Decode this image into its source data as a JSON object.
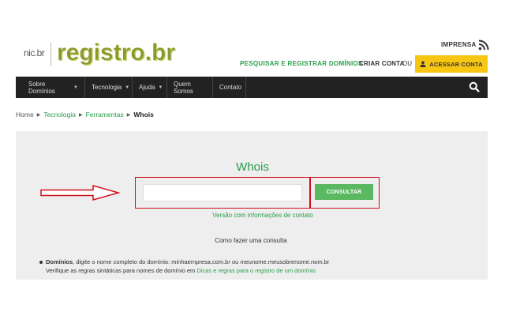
{
  "header": {
    "logo_small": "nic.br",
    "logo_main": "registro.br",
    "imprensa": "IMPRENSA",
    "pesquisar": "PESQUISAR E REGISTRAR DOMÍNIOS",
    "criar_conta": "CRIAR CONTA",
    "ou": "OU",
    "acessar_conta": "ACESSAR CONTA",
    "accent_color": "#2a9d4a",
    "button_color": "#f6c613"
  },
  "nav": {
    "items": [
      {
        "label": "Sobre Domínios",
        "caret": "▼"
      },
      {
        "label": "Tecnologia",
        "caret": "▼"
      },
      {
        "label": "Ajuda",
        "caret": "▼"
      },
      {
        "label": "Quem Somos",
        "caret": ""
      },
      {
        "label": "Contato",
        "caret": ""
      }
    ]
  },
  "breadcrumb": {
    "home": "Home",
    "items": [
      "Tecnologia",
      "Ferramentas"
    ],
    "current": "Whois",
    "separator": "▶"
  },
  "main": {
    "title": "Whois",
    "input_value": "",
    "button_label": "CONSULTAR",
    "versao_link": "Versão com informações de contato",
    "como_fazer": "Como fazer uma consulta",
    "bullet": {
      "term": "Domínios",
      "text1": ", digite o nome completo do domínio: minhaempresa.com.br ou meunome.meusobrenome.nom.br",
      "text2_prefix": "Verifique as regras sintáticas para nomes de domínio em ",
      "text2_link": "Dicas e regras para o registro de um domínio"
    }
  }
}
